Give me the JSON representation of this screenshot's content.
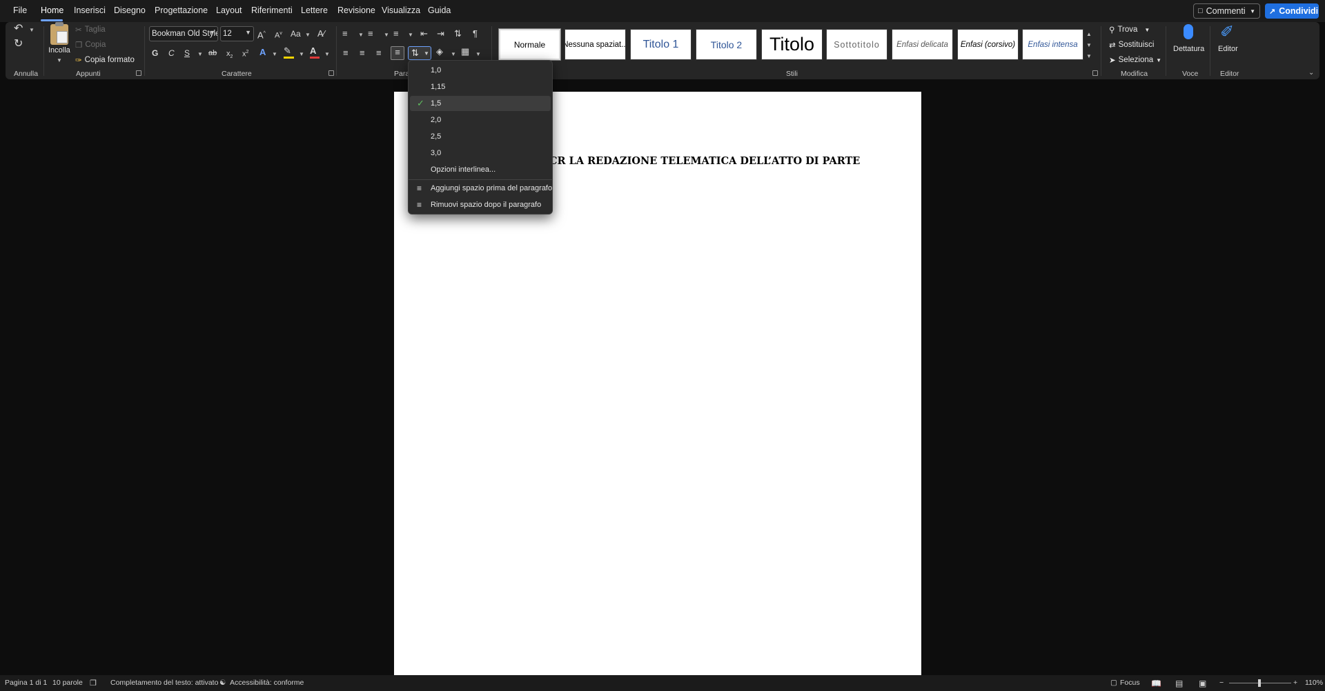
{
  "menubar": {
    "tabs": [
      "File",
      "Home",
      "Inserisci",
      "Disegno",
      "Progettazione",
      "Layout",
      "Riferimenti",
      "Lettere",
      "Revisione",
      "Visualizza",
      "Guida"
    ],
    "active_tab": "Home",
    "comments_label": "Commenti",
    "share_label": "Condividi"
  },
  "ribbon": {
    "clipboard": {
      "paste": "Incolla",
      "cut": "Taglia",
      "copy": "Copia",
      "format_painter": "Copia formato"
    },
    "font": {
      "name": "Bookman Old Style",
      "size": "12",
      "bold": "G",
      "italic": "C",
      "underline": "S",
      "change_case": "Aa"
    },
    "styles": [
      {
        "label": "Normale"
      },
      {
        "label": "Nessuna spaziat..."
      },
      {
        "label": "Titolo 1"
      },
      {
        "label": "Titolo 2"
      },
      {
        "label": "Titolo"
      },
      {
        "label": "Sottotitolo"
      },
      {
        "label": "Enfasi delicata"
      },
      {
        "label": "Enfasi (corsivo)"
      },
      {
        "label": "Enfasi intensa"
      }
    ],
    "editing": {
      "find": "Trova",
      "replace": "Sostituisci",
      "select": "Seleziona"
    },
    "voice": {
      "dictate": "Dettatura"
    },
    "editor": {
      "label": "Editor"
    },
    "group_labels": {
      "undo": "Annulla",
      "clipboard": "Appunti",
      "font": "Carattere",
      "paragraph": "Para",
      "styles": "Stili",
      "editing": "Modifica",
      "voice": "Voce",
      "editor": "Editor"
    }
  },
  "line_spacing_menu": {
    "options": [
      "1,0",
      "1,15",
      "1,5",
      "2,0",
      "2,5",
      "3,0"
    ],
    "selected": "1,5",
    "more_options": "Opzioni interlinea...",
    "add_space_before": "Aggiungi spazio prima del paragrafo",
    "remove_space_after": "Rimuovi spazio dopo il paragrafo"
  },
  "document": {
    "visible_heading": "CR LA REDAZIONE TELEMATICA DELL’ATTO DI PARTE"
  },
  "statusbar": {
    "page": "Pagina 1 di 1",
    "words": "10 parole",
    "text_prediction": "Completamento del testo: attivato",
    "accessibility": "Accessibilità: conforme",
    "focus": "Focus",
    "zoom": "110%"
  },
  "colors": {
    "accent": "#1f6fe0",
    "tab_underline": "#6ea2ff",
    "highlight": "#f5d400",
    "font_color": "#e03a3a"
  }
}
